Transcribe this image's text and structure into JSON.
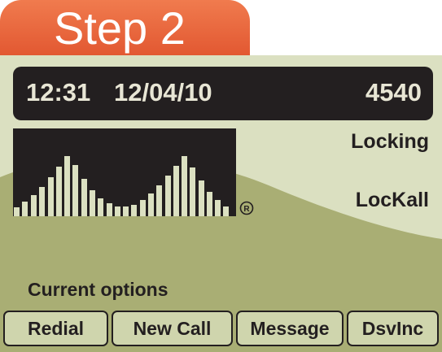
{
  "header": {
    "step_title": "Step 2"
  },
  "status_bar": {
    "time": "12:31",
    "date": "12/04/10",
    "extension": "4540"
  },
  "info": {
    "line1": "Locking",
    "line2": "LocKall"
  },
  "logo": {
    "mark": "®"
  },
  "options": {
    "heading": "Current options"
  },
  "softkeys": [
    {
      "label": "Redial"
    },
    {
      "label": "New Call"
    },
    {
      "label": "Message"
    },
    {
      "label": "DsvInc"
    }
  ],
  "colors": {
    "step_tab": "#e8643a",
    "screen_background": "#dbe0c1",
    "screen_wave": "#a9ae74",
    "status_bar": "#231f20",
    "status_text": "#e8e6d5"
  }
}
